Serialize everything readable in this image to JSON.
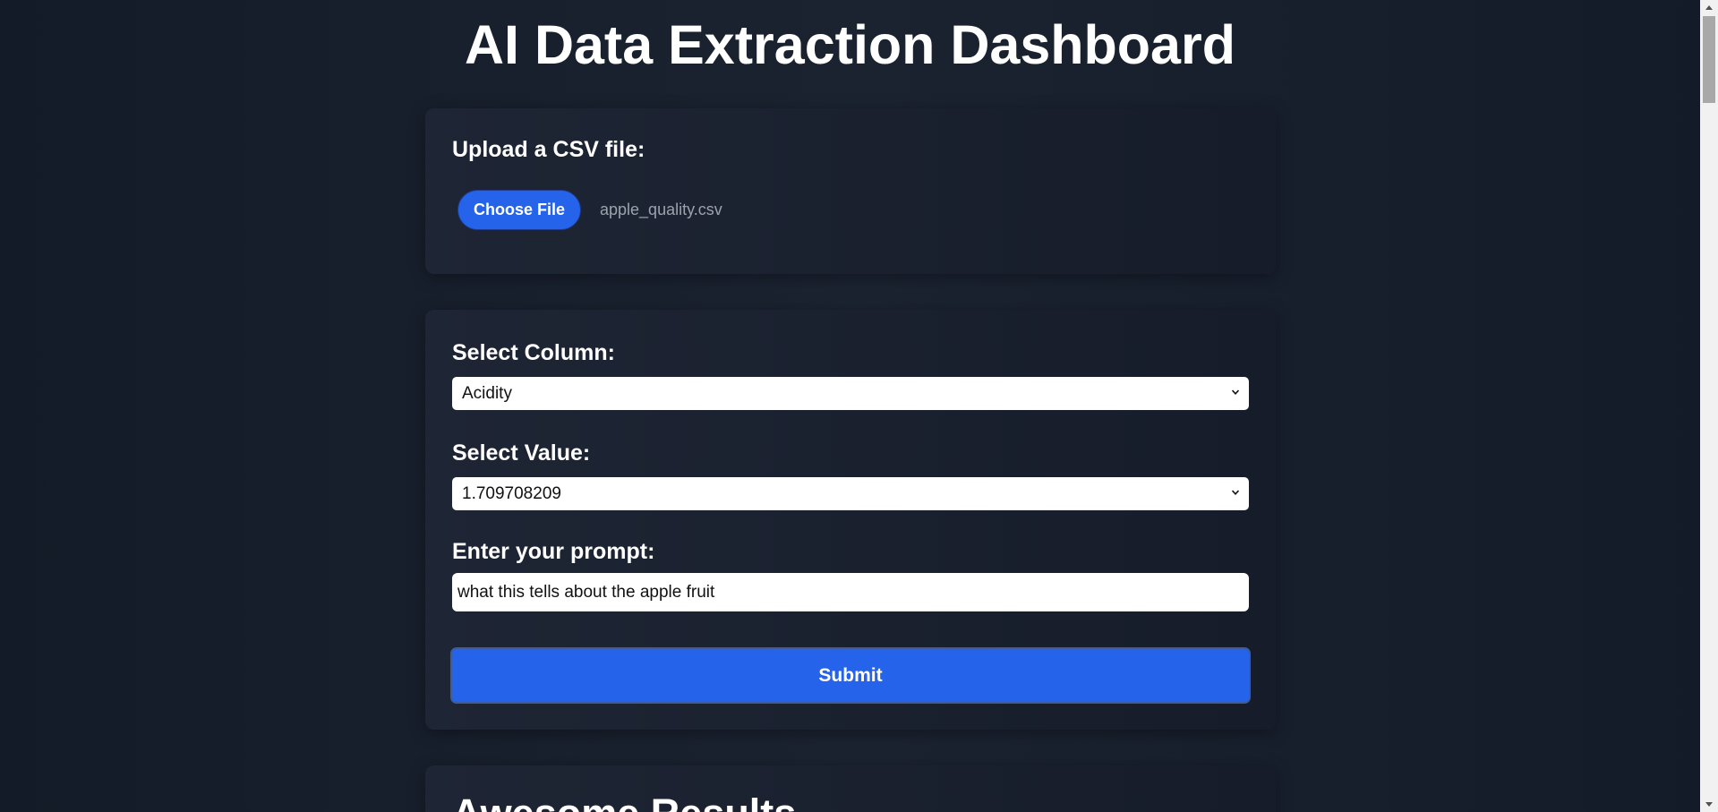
{
  "page": {
    "title": "AI Data Extraction Dashboard"
  },
  "upload": {
    "label": "Upload a CSV file:",
    "button_label": "Choose File",
    "file_name": "apple_quality.csv"
  },
  "form": {
    "column_label": "Select Column:",
    "column_selected": "Acidity",
    "value_label": "Select Value:",
    "value_selected": "1.709708209",
    "prompt_label": "Enter your prompt:",
    "prompt_value": "what this tells about the apple fruit",
    "submit_label": "Submit"
  },
  "results": {
    "title": "Awesome Results"
  },
  "icons": {
    "select_chevron": "chevron-down-icon",
    "scroll_up": "arrow-up-icon",
    "scroll_down": "arrow-down-icon"
  },
  "colors": {
    "accent": "#2563eb",
    "background": "#1b2331",
    "card": "#1e2534"
  }
}
